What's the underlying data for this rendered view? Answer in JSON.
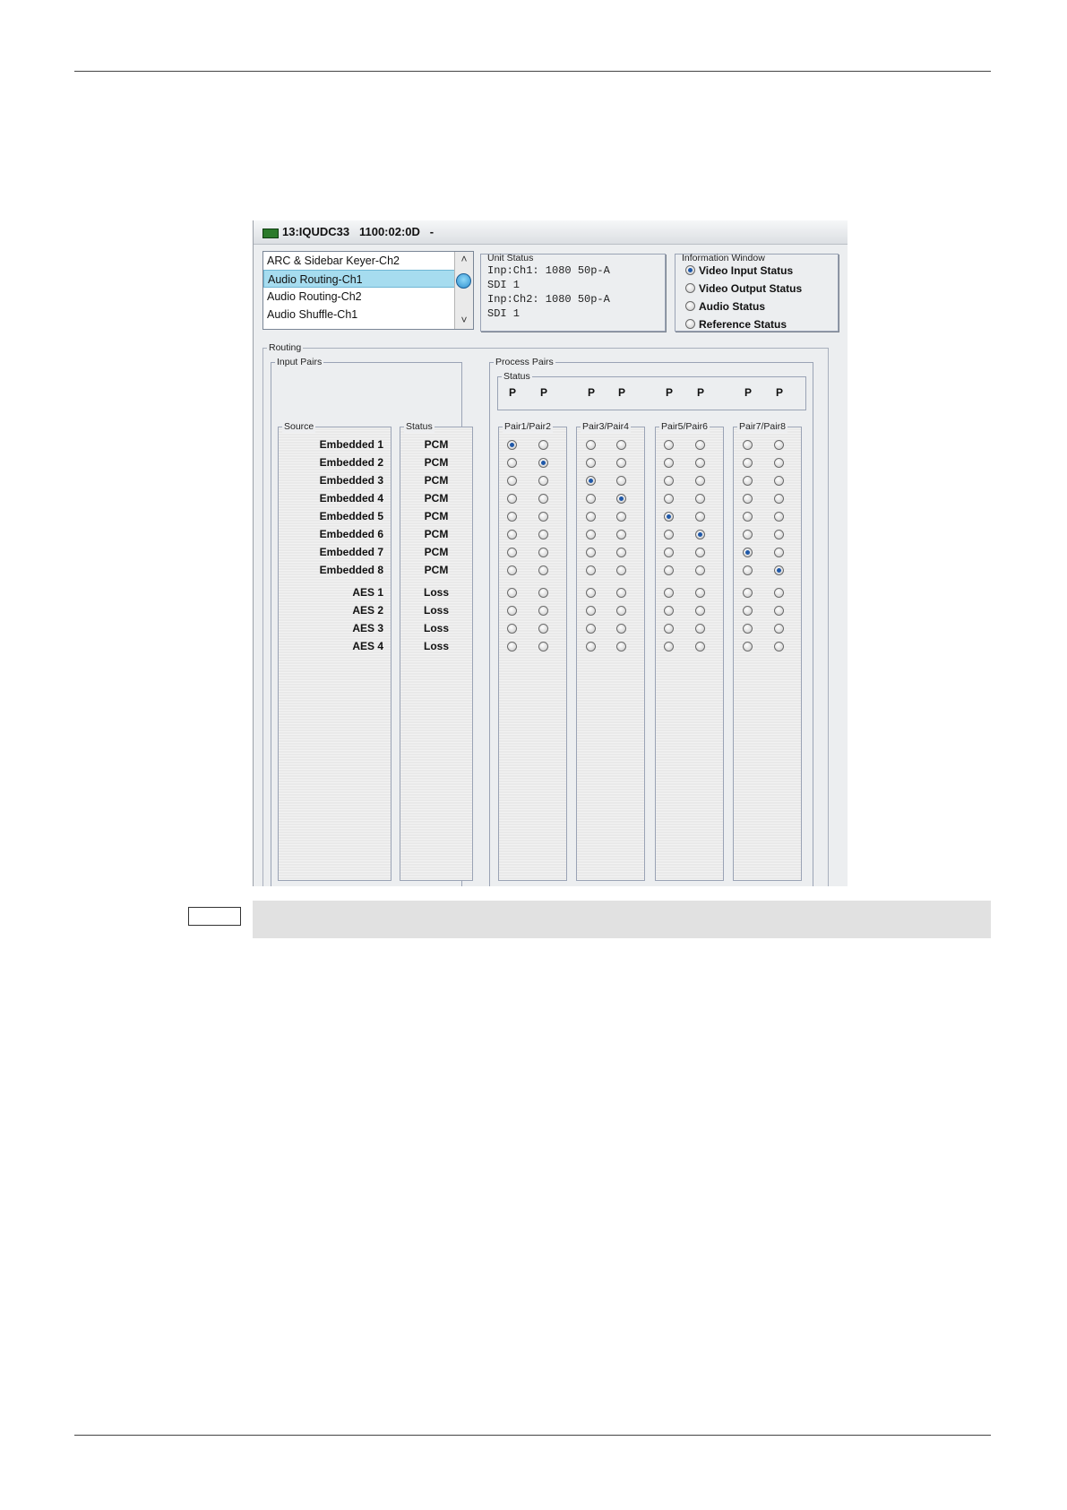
{
  "window": {
    "title": "13:IQUDC33   1100:02:0D   -"
  },
  "menu_list": {
    "items": [
      {
        "label": "ARC & Sidebar Keyer-Ch2",
        "selected": false
      },
      {
        "label": "Audio Routing-Ch1",
        "selected": true
      },
      {
        "label": "Audio Routing-Ch2",
        "selected": false
      },
      {
        "label": "Audio Shuffle-Ch1",
        "selected": false
      }
    ],
    "scroll_up": "˄",
    "scroll_down": "˅"
  },
  "unit_status": {
    "legend": "Unit Status",
    "lines": [
      "Inp:Ch1: 1080 50p-A",
      "SDI 1",
      "Inp:Ch2: 1080 50p-A",
      "SDI 1"
    ]
  },
  "info_window": {
    "legend": "Information Window",
    "options": [
      {
        "label": "Video Input Status",
        "selected": true
      },
      {
        "label": "Video Output Status",
        "selected": false
      },
      {
        "label": "Audio Status",
        "selected": false
      },
      {
        "label": "Reference Status",
        "selected": false
      }
    ]
  },
  "routing": {
    "legend": "Routing",
    "input_pairs_legend": "Input Pairs",
    "source_legend": "Source",
    "status_legend": "Status",
    "process_pairs_legend": "Process Pairs",
    "process_status_legend": "Status",
    "process_status": [
      "P",
      "P",
      "P",
      "P",
      "P",
      "P",
      "P",
      "P"
    ],
    "group_labels": [
      "Pair1/Pair2",
      "Pair3/Pair4",
      "Pair5/Pair6",
      "Pair7/Pair8"
    ],
    "sources": [
      {
        "name": "Embedded 1",
        "status": "PCM"
      },
      {
        "name": "Embedded 2",
        "status": "PCM"
      },
      {
        "name": "Embedded 3",
        "status": "PCM"
      },
      {
        "name": "Embedded 4",
        "status": "PCM"
      },
      {
        "name": "Embedded 5",
        "status": "PCM"
      },
      {
        "name": "Embedded 6",
        "status": "PCM"
      },
      {
        "name": "Embedded 7",
        "status": "PCM"
      },
      {
        "name": "Embedded 8",
        "status": "PCM"
      },
      {
        "name": "AES 1",
        "status": "Loss"
      },
      {
        "name": "AES 2",
        "status": "Loss"
      },
      {
        "name": "AES 3",
        "status": "Loss"
      },
      {
        "name": "AES 4",
        "status": "Loss"
      }
    ],
    "selected_source_row_per_pair": [
      1,
      2,
      3,
      4,
      5,
      6,
      7,
      8
    ]
  }
}
